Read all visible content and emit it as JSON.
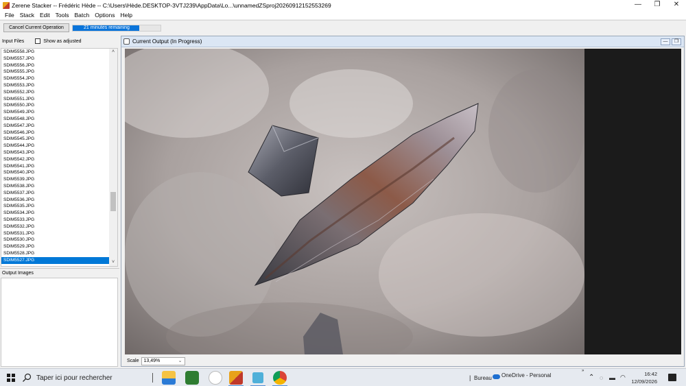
{
  "window": {
    "title": "Zerene Stacker -- Frédéric Hède -- C:\\Users\\Hède.DESKTOP-3VTJ239\\AppData\\Lo...\\unnamedZSproj20260912152553269",
    "minimize": "—",
    "maximize": "❐",
    "close": "✕"
  },
  "menu": [
    "File",
    "Stack",
    "Edit",
    "Tools",
    "Batch",
    "Options",
    "Help"
  ],
  "toolbar": {
    "cancel_label": "Cancel Current Operation",
    "progress_text": "21 minutes remaining",
    "progress_fraction": 0.76
  },
  "left_panel": {
    "input_label": "Input Files",
    "show_adjusted_label": "Show as adjusted",
    "files": [
      "SDIM5558.JPG",
      "SDIM5557.JPG",
      "SDIM5556.JPG",
      "SDIM5555.JPG",
      "SDIM5554.JPG",
      "SDIM5553.JPG",
      "SDIM5552.JPG",
      "SDIM5551.JPG",
      "SDIM5550.JPG",
      "SDIM5549.JPG",
      "SDIM5548.JPG",
      "SDIM5547.JPG",
      "SDIM5546.JPG",
      "SDIM5545.JPG",
      "SDIM5544.JPG",
      "SDIM5543.JPG",
      "SDIM5542.JPG",
      "SDIM5541.JPG",
      "SDIM5540.JPG",
      "SDIM5539.JPG",
      "SDIM5538.JPG",
      "SDIM5537.JPG",
      "SDIM5536.JPG",
      "SDIM5535.JPG",
      "SDIM5534.JPG",
      "SDIM5533.JPG",
      "SDIM5532.JPG",
      "SDIM5531.JPG",
      "SDIM5530.JPG",
      "SDIM5529.JPG",
      "SDIM5528.JPG",
      "SDIM5527.JPG"
    ],
    "selected_file": "SDIM5527.JPG",
    "output_label": "Output Images"
  },
  "output_window": {
    "title": "Current Output (In Progress)",
    "scale_label": "Scale",
    "scale_value": "13,49%"
  },
  "taskbar": {
    "search_placeholder": "Taper ici pour rechercher",
    "apps": [
      "file-explorer",
      "tripadvisor",
      "keepass",
      "zerene-stacker",
      "3d-viewer",
      "chrome"
    ],
    "bureau_label": "Bureau",
    "onedrive_label": "OneDrive - Personal",
    "time": "16:42",
    "date": "12/09/2026"
  },
  "colors": {
    "accent": "#0078d7",
    "progress": "#0a74da"
  }
}
